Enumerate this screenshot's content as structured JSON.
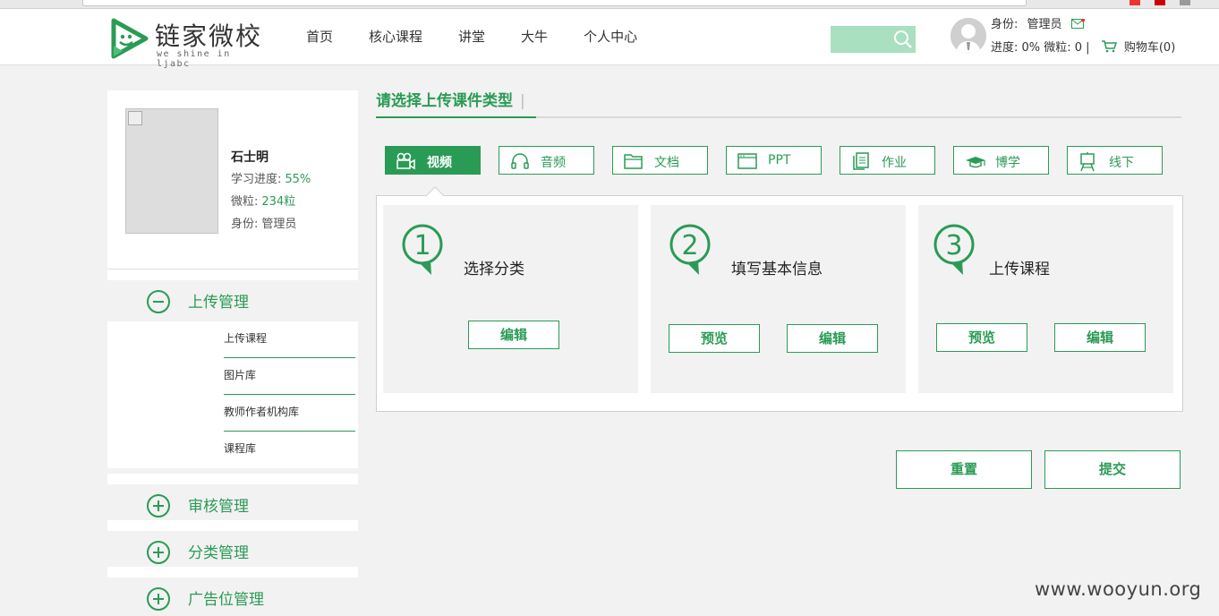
{
  "site": {
    "logo_name": "链家微校",
    "logo_slogan": "we shine in ljabc",
    "brand_color": "#2a9b55"
  },
  "nav": [
    "首页",
    "核心课程",
    "讲堂",
    "大牛",
    "个人中心"
  ],
  "search": {
    "icon": "search-icon"
  },
  "user": {
    "role_label": "身份:",
    "role_value": "管理员",
    "progress_text": "进度: 0% 微粒: 0 |",
    "cart_text": "购物车(0)"
  },
  "profile": {
    "name": "石士明",
    "progress_label": "学习进度:",
    "progress_value": "55%",
    "particles_label": "微粒:",
    "particles_value": "234粒",
    "role_label": "身份:",
    "role_value": "管理员"
  },
  "sidebar": {
    "upload_title": "上传管理",
    "upload_items": [
      "上传课程",
      "图片库",
      "教师作者机构库",
      "课程库"
    ],
    "review_title": "审核管理",
    "category_title": "分类管理",
    "ad_title": "广告位管理"
  },
  "main": {
    "select_title": "请选择上传课件类型",
    "separator": "|",
    "types": [
      "视频",
      "音频",
      "文档",
      "PPT",
      "作业",
      "博学",
      "线下"
    ],
    "steps": [
      {
        "num": "1",
        "title": "选择分类",
        "buttons": [
          "编辑"
        ]
      },
      {
        "num": "2",
        "title": "填写基本信息",
        "buttons": [
          "预览",
          "编辑"
        ]
      },
      {
        "num": "3",
        "title": "上传课程",
        "buttons": [
          "预览",
          "编辑"
        ]
      }
    ],
    "reset": "重置",
    "submit": "提交"
  },
  "watermark": "www.wooyun.org"
}
